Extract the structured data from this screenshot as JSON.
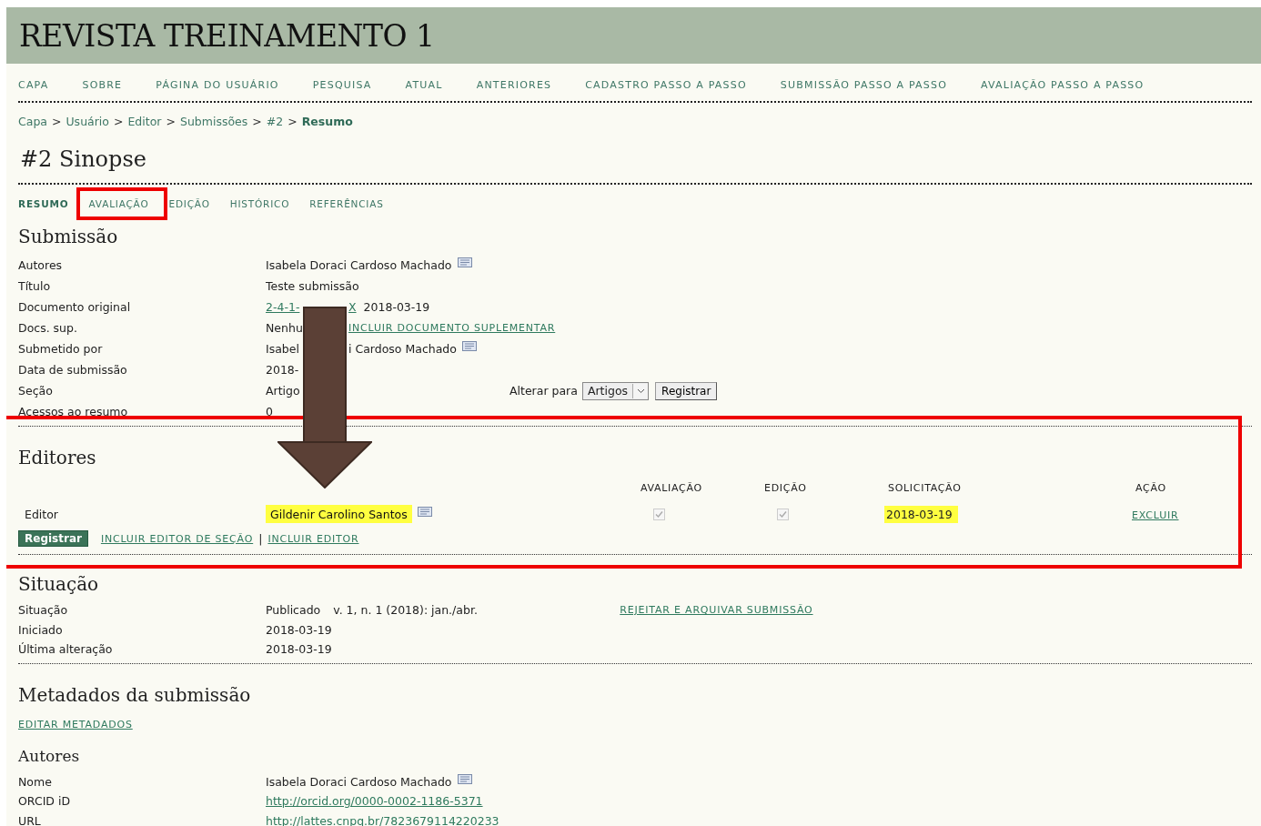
{
  "site_title": "REVISTA TREINAMENTO 1",
  "nav": [
    "CAPA",
    "SOBRE",
    "PÁGINA DO USUÁRIO",
    "PESQUISA",
    "ATUAL",
    "ANTERIORES",
    "CADASTRO PASSO A PASSO",
    "SUBMISSÃO PASSO A PASSO",
    "AVALIAÇÃO PASSO A PASSO"
  ],
  "breadcrumb": [
    {
      "label": "Capa",
      "current": false
    },
    {
      "label": "Usuário",
      "current": false
    },
    {
      "label": "Editor",
      "current": false
    },
    {
      "label": "Submissões",
      "current": false
    },
    {
      "label": "#2",
      "current": false
    },
    {
      "label": "Resumo",
      "current": true
    }
  ],
  "breadcrumb_separator": ">",
  "page_title": "#2 Sinopse",
  "tabs": [
    {
      "label": "RESUMO",
      "selected": true,
      "framed": false
    },
    {
      "label": "AVALIAÇÃO",
      "selected": false,
      "framed": true
    },
    {
      "label": "EDIÇÃO",
      "selected": false,
      "framed": false
    },
    {
      "label": "HISTÓRICO",
      "selected": false,
      "framed": false
    },
    {
      "label": "REFERÊNCIAS",
      "selected": false,
      "framed": false
    }
  ],
  "submission": {
    "heading": "Submissão",
    "rows": [
      {
        "label": "Autores",
        "kind": "person",
        "value": "Isabela Doraci Cardoso Machado"
      },
      {
        "label": "Título",
        "kind": "text",
        "value": "Teste submissão"
      },
      {
        "label": "Documento original",
        "kind": "file",
        "link": "2-4-1-",
        "link_tail": "X",
        "value": "2018-03-19"
      },
      {
        "label": "Docs. sup.",
        "kind": "split_link",
        "value": "Nenhu",
        "link": "INCLUIR DOCUMENTO SUPLEMENTAR"
      },
      {
        "label": "Submetido por",
        "kind": "split_person",
        "value": "Isabel",
        "value_tail": "i Cardoso Machado"
      },
      {
        "label": "Data de submissão",
        "kind": "text",
        "value": "2018-"
      },
      {
        "label": "Seção",
        "kind": "section",
        "value": "Artigo",
        "change_label": "Alterar para",
        "select": "Artigos",
        "button": "Registrar"
      },
      {
        "label": "Acessos ao resumo",
        "kind": "text",
        "value": "0"
      }
    ]
  },
  "editors": {
    "heading": "Editores",
    "framed": true,
    "columns": [
      "AVALIAÇÃO",
      "EDIÇÃO",
      "SOLICITAÇÃO",
      "AÇÃO"
    ],
    "rows": [
      {
        "role": "Editor",
        "name": "Gildenir Carolino Santos",
        "name_highlighted": true,
        "review_checked": true,
        "editing_checked": true,
        "requested": "2018-03-19",
        "requested_highlighted": true,
        "action": "EXCLUIR"
      }
    ],
    "button": "Registrar",
    "links": [
      "INCLUIR EDITOR DE SEÇÃO",
      "INCLUIR EDITOR"
    ],
    "link_separator": "|"
  },
  "status": {
    "heading": "Situação",
    "rows": [
      {
        "label": "Situação",
        "value": "Publicado",
        "extra": "v. 1, n. 1 (2018): jan./abr.",
        "link": "REJEITAR E ARQUIVAR SUBMISSÃO"
      },
      {
        "label": "Iniciado",
        "value": "2018-03-19"
      },
      {
        "label": "Última alteração",
        "value": "2018-03-19"
      }
    ]
  },
  "metadata": {
    "heading": "Metadados da submissão",
    "edit_link": "EDITAR METADADOS",
    "authors_heading": "Autores",
    "rows": [
      {
        "label": "Nome",
        "kind": "person",
        "value": "Isabela Doraci Cardoso Machado"
      },
      {
        "label": "ORCID iD",
        "kind": "link",
        "value": "http://orcid.org/0000-0002-1186-5371"
      },
      {
        "label": "URL",
        "kind": "link",
        "value": "http://lattes.cnpq.br/7823679114220233"
      }
    ]
  },
  "annotation_arrow": true
}
